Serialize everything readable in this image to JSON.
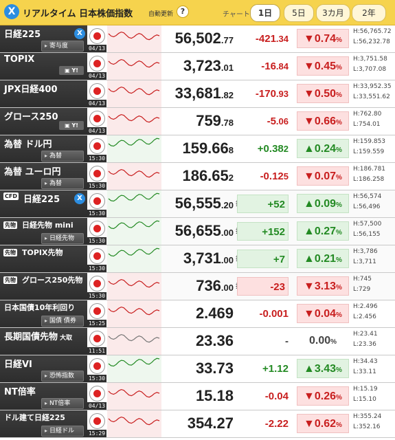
{
  "header": {
    "title": "リアルタイム 日本株価指数",
    "auto": "自動更新",
    "help": "?",
    "chart_label": "チャート:",
    "tabs": [
      "1日",
      "5日",
      "3カ月",
      "2年"
    ]
  },
  "rows": [
    {
      "name": "日経225",
      "sub": "寄与度",
      "date": "04/13",
      "val": "56,502",
      "vals": ".77",
      "chg": "-421",
      "chgs": ".34",
      "pct": "▼0.74",
      "pcts": "%",
      "h": "H:56,765.72",
      "l": "L:56,232.78",
      "color": "red"
    },
    {
      "name": "TOPIX",
      "sub": "Y!",
      "date": "04/13",
      "val": "3,723",
      "vals": ".01",
      "chg": "-16",
      "chgs": ".84",
      "pct": "▼0.45",
      "pcts": "%",
      "h": "H:3,751.58",
      "l": "L:3,707.08",
      "color": "red"
    },
    {
      "name": "JPX日経400",
      "sub": "",
      "date": "04/13",
      "val": "33,681",
      "vals": ".82",
      "chg": "-170",
      "chgs": ".93",
      "pct": "▼0.50",
      "pcts": "%",
      "h": "H:33,952.35",
      "l": "L:33,551.62",
      "color": "red"
    },
    {
      "name": "グロース250",
      "sub": "Y!",
      "date": "04/13",
      "val": "759",
      "vals": ".78",
      "chg": "-5",
      "chgs": ".06",
      "pct": "▼0.66",
      "pcts": "%",
      "h": "H:762.80",
      "l": "L:754.01",
      "color": "red"
    },
    {
      "name": "為替 ドル円",
      "sub": "為替",
      "date": "15:30",
      "val": "159.66",
      "vals": "8",
      "chg": "+0.38",
      "chgs": "2",
      "pct": "▲0.24",
      "pcts": "%",
      "h": "H:159.853",
      "l": "L:159.559",
      "color": "green"
    },
    {
      "name": "為替 ユーロ円",
      "sub": "為替",
      "date": "15:30",
      "val": "186.65",
      "vals": "2",
      "chg": "-0.12",
      "chgs": "5",
      "pct": "▼0.07",
      "pcts": "%",
      "h": "H:186.781",
      "l": "L:186.258",
      "color": "red"
    },
    {
      "name": "日経225",
      "sub": "",
      "date": "15:30",
      "val": "56,555",
      "vals": ".20",
      "shisu": "指数比:",
      "chg": "+52",
      "chgs": "",
      "pct": "▲0.09",
      "pcts": "%",
      "h": "H:56,574",
      "l": "L:56,496",
      "color": "green",
      "cfd": "CFD"
    },
    {
      "name": "日経先物 mini",
      "sub": "日経先物",
      "date": "15:30",
      "val": "56,655",
      "vals": ".00",
      "shisu": "指数比:",
      "chg": "+152",
      "chgs": "",
      "pct": "▲0.27",
      "pcts": "%",
      "h": "H:57,500",
      "l": "L:56,155",
      "color": "green",
      "tag": "先物"
    },
    {
      "name": "TOPIX先物",
      "sub": "",
      "date": "15:30",
      "val": "3,731",
      "vals": ".00",
      "shisu": "指数比:",
      "chg": "+7",
      "chgs": "",
      "pct": "▲0.21",
      "pcts": "%",
      "h": "H:3,786",
      "l": "L:3,711",
      "color": "green",
      "tag": "先物"
    },
    {
      "name": "グロース250先物",
      "sub": "",
      "date": "15:30",
      "val": "736",
      "vals": ".00",
      "shisu": "指数比:",
      "chg": "-23",
      "chgs": "",
      "pct": "▼3.13",
      "pcts": "%",
      "h": "H:745",
      "l": "L:729",
      "color": "red",
      "tag": "先物"
    },
    {
      "name": "日本国債10年利回り",
      "sub": "国債 債券",
      "date": "15:25",
      "val": "2.469",
      "vals": "",
      "chg": "-0.001",
      "chgs": "",
      "pct": "▼0.04",
      "pcts": "%",
      "h": "H:2.496",
      "l": "L:2.456",
      "color": "red"
    },
    {
      "name": "長期国債先物",
      "sub": "",
      "date": "11:51",
      "val": "23.36",
      "vals": "",
      "chg": "-",
      "chgs": "",
      "pct": "0.00",
      "pcts": "%",
      "h": "H:23.41",
      "l": "L:23.36",
      "color": "gray",
      "extra": "大取"
    },
    {
      "name": "日経VI",
      "sub": "恐怖指数",
      "date": "15:30",
      "val": "33.73",
      "vals": "",
      "chg": "+1.12",
      "chgs": "",
      "pct": "▲3.43",
      "pcts": "%",
      "h": "H:34.43",
      "l": "L:33.11",
      "color": "green"
    },
    {
      "name": "NT倍率",
      "sub": "NT倍率",
      "date": "04/13",
      "val": "15.18",
      "vals": "",
      "chg": "-0.04",
      "chgs": "",
      "pct": "▼0.26",
      "pcts": "%",
      "h": "H:15.19",
      "l": "L:15.10",
      "color": "red"
    },
    {
      "name": "ドル建て日経225",
      "sub": "日経ドル",
      "date": "15:29",
      "val": "354.27",
      "vals": "",
      "chg": "-2.22",
      "chgs": "",
      "pct": "▼0.62",
      "pcts": "%",
      "h": "H:355.24",
      "l": "L:352.16",
      "color": "red"
    }
  ],
  "colors": {
    "header": "#f6d34d",
    "up": "#238a23",
    "down": "#c81e1e",
    "label_bg": "#333333"
  }
}
